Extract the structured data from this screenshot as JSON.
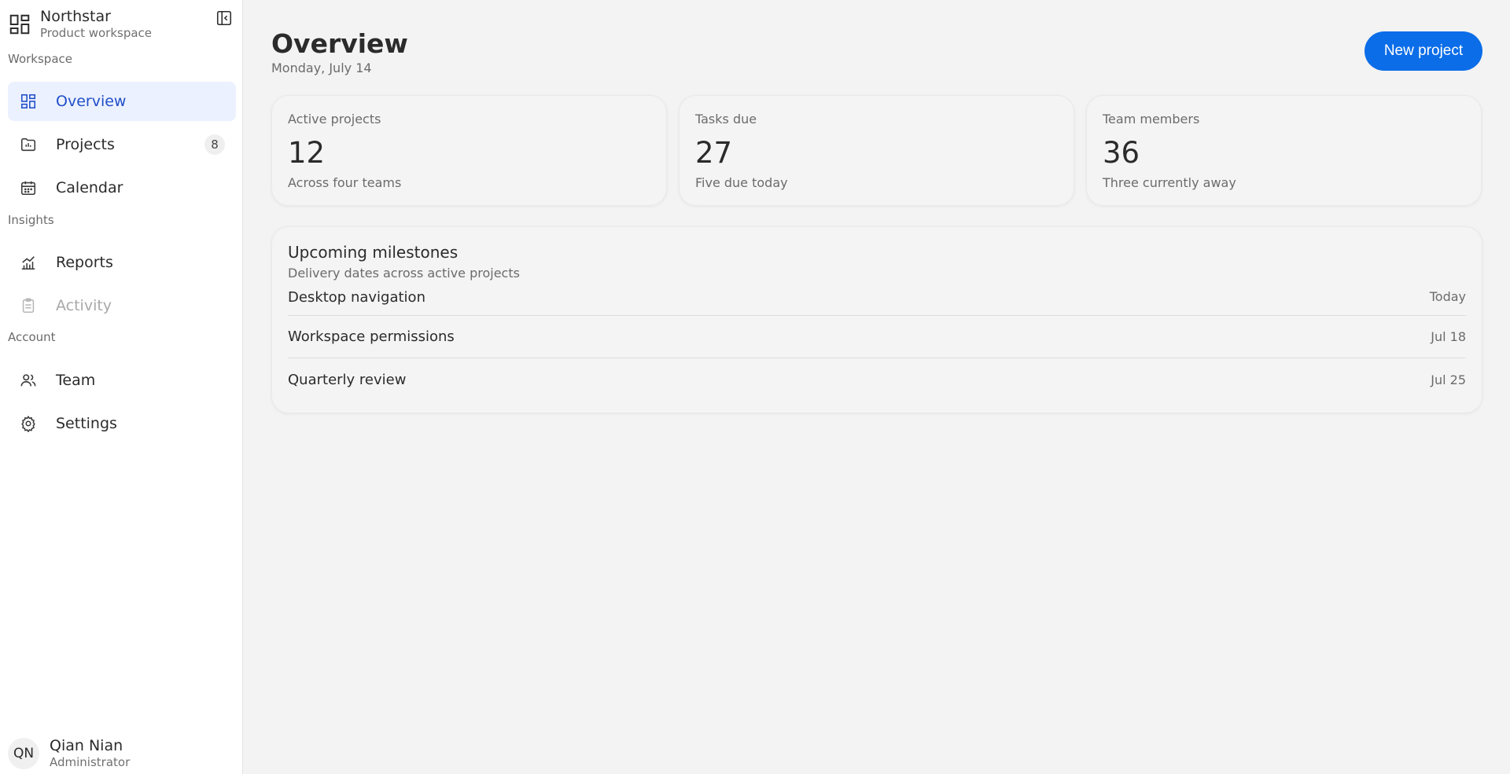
{
  "brand": {
    "name": "Northstar",
    "subtitle": "Product workspace"
  },
  "sidebar": {
    "sections": [
      {
        "label": "Workspace"
      },
      {
        "label": "Insights"
      },
      {
        "label": "Account"
      }
    ],
    "items": [
      {
        "label": "Overview",
        "icon": "dashboard-icon",
        "active": true
      },
      {
        "label": "Projects",
        "icon": "folder-chart-icon",
        "badge": "8"
      },
      {
        "label": "Calendar",
        "icon": "calendar-icon"
      },
      {
        "label": "Reports",
        "icon": "chart-line-icon"
      },
      {
        "label": "Activity",
        "icon": "clipboard-icon",
        "disabled": true
      },
      {
        "label": "Team",
        "icon": "people-icon"
      },
      {
        "label": "Settings",
        "icon": "gear-icon"
      }
    ]
  },
  "user": {
    "initials": "QN",
    "name": "Qian Nian",
    "role": "Administrator"
  },
  "header": {
    "title": "Overview",
    "date": "Monday, July 14",
    "new_project_label": "New project"
  },
  "cards": [
    {
      "label": "Active projects",
      "value": "12",
      "sub": "Across four teams"
    },
    {
      "label": "Tasks due",
      "value": "27",
      "sub": "Five due today"
    },
    {
      "label": "Team members",
      "value": "36",
      "sub": "Three currently away"
    }
  ],
  "milestones": {
    "title": "Upcoming milestones",
    "subtitle": "Delivery dates across active projects",
    "rows": [
      {
        "name": "Desktop navigation",
        "date": "Today"
      },
      {
        "name": "Workspace permissions",
        "date": "Jul 18"
      },
      {
        "name": "Quarterly review",
        "date": "Jul 25"
      }
    ]
  },
  "colors": {
    "accent": "#0b6de8",
    "active_nav_bg": "#ecf1ff",
    "active_nav_text": "#1f4fc7"
  }
}
